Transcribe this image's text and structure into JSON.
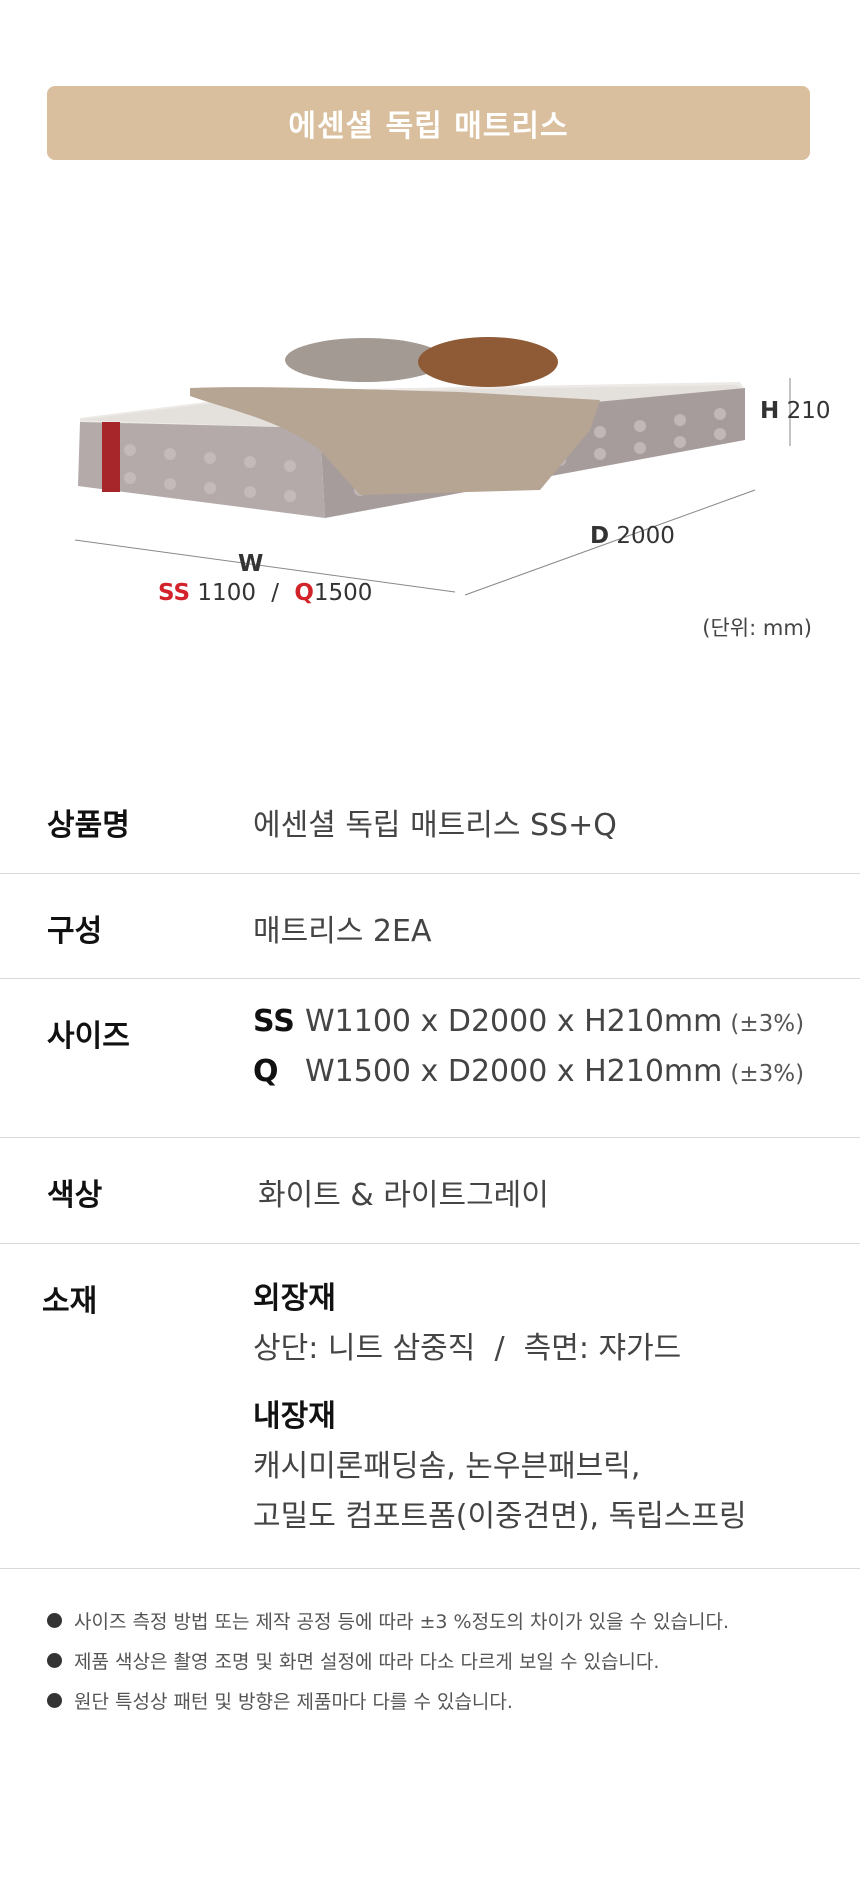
{
  "banner": {
    "title": "에센셜 독립 매트리스"
  },
  "dimensions": {
    "height_label": "H",
    "height_value": "210",
    "depth_label": "D",
    "depth_value": "2000",
    "width_label": "W",
    "ss_label": "SS",
    "ss_value": "1100",
    "sep": "/",
    "q_label": "Q",
    "q_value": "1500",
    "unit": "(단위: mm)"
  },
  "specs": {
    "name": {
      "label": "상품명",
      "value": "에센셜 독립 매트리스 SS+Q"
    },
    "composition": {
      "label": "구성",
      "value": "매트리스 2EA"
    },
    "size": {
      "label": "사이즈",
      "rows": [
        {
          "code": "SS",
          "dims": "W1100 x D2000 x H210mm",
          "tolerance": "(±3%)"
        },
        {
          "code": "Q",
          "dims": "W1500 x D2000 x H210mm",
          "tolerance": "(±3%)"
        }
      ]
    },
    "color": {
      "label": "색상",
      "value": "화이트 & 라이트그레이"
    },
    "material": {
      "label": "소재",
      "outer_title": "외장재",
      "outer_value": "상단: 니트 삼중직  /  측면: 쟈가드",
      "inner_title": "내장재",
      "inner_line1": "캐시미론패딩솜, 논우븐패브릭,",
      "inner_line2": "고밀도 컴포트폼(이중견면), 독립스프링"
    }
  },
  "notes": [
    "사이즈 측정 방법 또는 제작 공정 등에 따라 ±3 %정도의 차이가 있을 수 있습니다.",
    "제품 색상은 촬영 조명 및 화면 설정에 따라 다소 다르게 보일 수 있습니다.",
    "원단 특성상 패턴 및 방향은 제품마다 다를 수 있습니다."
  ]
}
